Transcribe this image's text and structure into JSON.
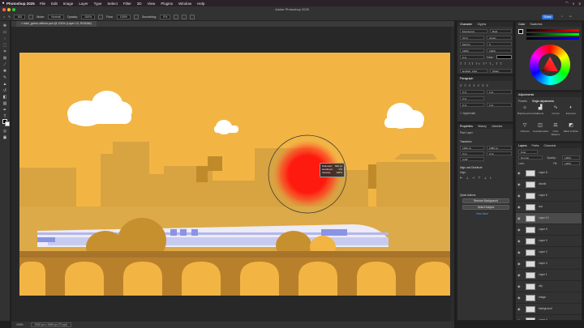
{
  "menubar": {
    "app_name": "Photoshop 2025",
    "items": [
      "File",
      "Edit",
      "Image",
      "Layer",
      "Type",
      "Select",
      "Filter",
      "3D",
      "View",
      "Plugins",
      "Window",
      "Help"
    ]
  },
  "titlebar": {
    "title": "Adobe Photoshop 2025"
  },
  "options": {
    "brush_size": "100",
    "mode_label": "Mode:",
    "mode_value": "Normal",
    "opacity_label": "Opacity:",
    "opacity_value": "100%",
    "flow_label": "Flow:",
    "flow_value": "100%",
    "smoothing_label": "Smoothing:",
    "smoothing_value": "0%",
    "share_label": "Share"
  },
  "document": {
    "tab_title": "train_green-effects.psd @ 100% (Layer 13, RGB/8#)"
  },
  "brush_tooltip": {
    "rows": [
      {
        "k": "Diameter:",
        "v": "500 px"
      },
      {
        "k": "Hardness:",
        "v": "0%"
      },
      {
        "k": "Opacity:",
        "v": "100%"
      }
    ]
  },
  "status": {
    "zoom": "100%",
    "doc_info": "1920 px x 1080 px (72 ppi)"
  },
  "character_panel": {
    "tabs": [
      "Character",
      "Glyphs"
    ],
    "font": "Montserrat",
    "style": "Bold",
    "size": "30 pt",
    "leading": "(Auto)",
    "kerning": "Metrics",
    "tracking": "0",
    "vscale": "100%",
    "hscale": "100%",
    "baseline": "0 pt",
    "color_label": "Color:",
    "language": "English: USA",
    "aa": "Sharp"
  },
  "paragraph_panel": {
    "tabs": [
      "Paragraph"
    ],
    "indent_left": "0 pt",
    "indent_right": "0 pt",
    "space_before": "0 pt",
    "space_after": "0 pt",
    "first_line": "0 pt",
    "hyphenate_label": "Hyphenate"
  },
  "properties_panel": {
    "tabs": [
      "Properties",
      "History",
      "Libraries"
    ],
    "section_label": "Pixel Layer",
    "transform_label": "Transform",
    "w_value": "1920 px",
    "h_value": "1080 px",
    "x_value": "0 px",
    "y_value": "0 px",
    "angle_value": "0.00°",
    "align_label": "Align and Distribute",
    "align_sub": "Align:",
    "quick_label": "Quick Actions",
    "qa_remove_bg": "Remove Background",
    "qa_select_subject": "Select Subject",
    "qa_more": "View More",
    "gradients_label": "Gradient Fill"
  },
  "color_panel": {
    "tabs": [
      "Color",
      "Swatches"
    ]
  },
  "adjustments_panel": {
    "tabs": [
      "Adjustments"
    ],
    "presets_label": "Presets",
    "single_label": "Single adjustments",
    "items": [
      "Brightness/Contrast",
      "Levels",
      "Curves",
      "Exposure",
      "Vibrance",
      "Hue/Saturation",
      "Color Balance",
      "Black & White"
    ]
  },
  "layers_panel": {
    "tabs": [
      "Layers",
      "Paths",
      "Channels"
    ],
    "kind_label": "Kind",
    "blend_mode": "Normal",
    "opacity_label": "Opacity:",
    "opacity_value": "100%",
    "lock_label": "Lock:",
    "fill_label": "Fill:",
    "fill_value": "100%",
    "layers": [
      {
        "name": "Layer 8"
      },
      {
        "name": "clouds"
      },
      {
        "name": "Layer 6"
      },
      {
        "name": "sun"
      },
      {
        "name": "Layer 13"
      },
      {
        "name": "Layer 5"
      },
      {
        "name": "Layer 3"
      },
      {
        "name": "Layer 2"
      },
      {
        "name": "Layer 4"
      },
      {
        "name": "Layer 1"
      },
      {
        "name": "city"
      },
      {
        "name": "bridge"
      },
      {
        "name": "background"
      },
      {
        "name": "Layer 0"
      }
    ]
  },
  "colors": {
    "sky": "#f2b544",
    "buildings": "#d6a23e",
    "red_sun": "#ff1a10",
    "bridge": "#b9802c",
    "train": "#ecebf6",
    "accent_blue": "#2d74da"
  }
}
